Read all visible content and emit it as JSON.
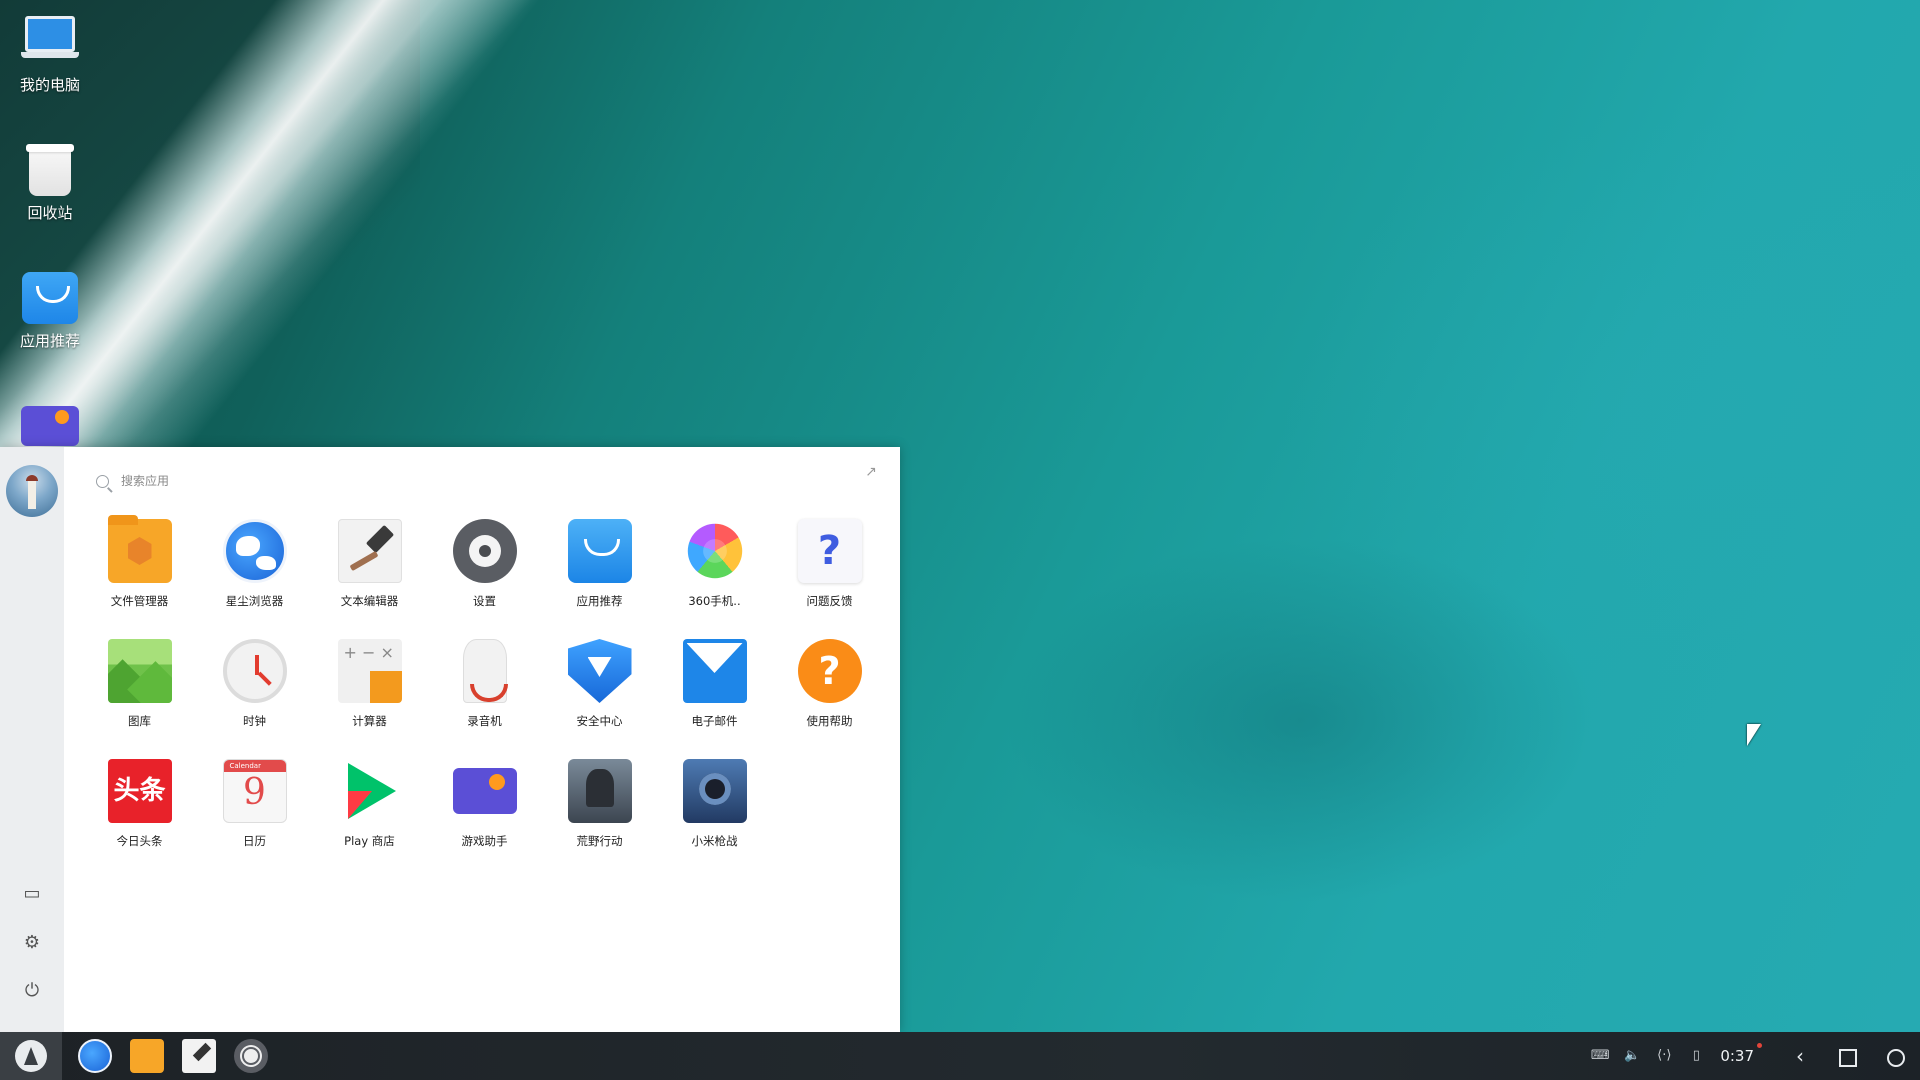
{
  "desktop": {
    "icons": [
      {
        "label": "我的电脑",
        "icon": "computer-icon"
      },
      {
        "label": "回收站",
        "icon": "trash-icon"
      },
      {
        "label": "应用推荐",
        "icon": "store-icon"
      },
      {
        "label": "",
        "icon": "game-assistant-icon"
      }
    ]
  },
  "start_menu": {
    "search_placeholder": "搜索应用",
    "apps": [
      {
        "label": "文件管理器",
        "icon": "file-manager-icon"
      },
      {
        "label": "星尘浏览器",
        "icon": "browser-icon"
      },
      {
        "label": "文本编辑器",
        "icon": "text-editor-icon"
      },
      {
        "label": "设置",
        "icon": "settings-icon"
      },
      {
        "label": "应用推荐",
        "icon": "app-store-icon"
      },
      {
        "label": "360手机..",
        "icon": "360-icon"
      },
      {
        "label": "问题反馈",
        "icon": "feedback-icon"
      },
      {
        "label": "图库",
        "icon": "gallery-icon"
      },
      {
        "label": "时钟",
        "icon": "clock-icon"
      },
      {
        "label": "计算器",
        "icon": "calculator-icon"
      },
      {
        "label": "录音机",
        "icon": "recorder-icon"
      },
      {
        "label": "安全中心",
        "icon": "security-icon"
      },
      {
        "label": "电子邮件",
        "icon": "mail-icon"
      },
      {
        "label": "使用帮助",
        "icon": "help-icon"
      },
      {
        "label": "今日头条",
        "icon": "toutiao-icon"
      },
      {
        "label": "日历",
        "icon": "calendar-icon"
      },
      {
        "label": "Play 商店",
        "icon": "play-store-icon"
      },
      {
        "label": "游戏助手",
        "icon": "game-assistant-icon"
      },
      {
        "label": "荒野行动",
        "icon": "knives-out-icon"
      },
      {
        "label": "小米枪战",
        "icon": "mi-gunfight-icon"
      }
    ],
    "toutiao_icon_text": "头条",
    "feedback_icon_text": "?",
    "help_icon_text": "?"
  },
  "taskbar": {
    "clock": "0:37"
  },
  "colors": {
    "accent_blue": "#1e86e8",
    "taskbar_bg": "#1d2226"
  }
}
